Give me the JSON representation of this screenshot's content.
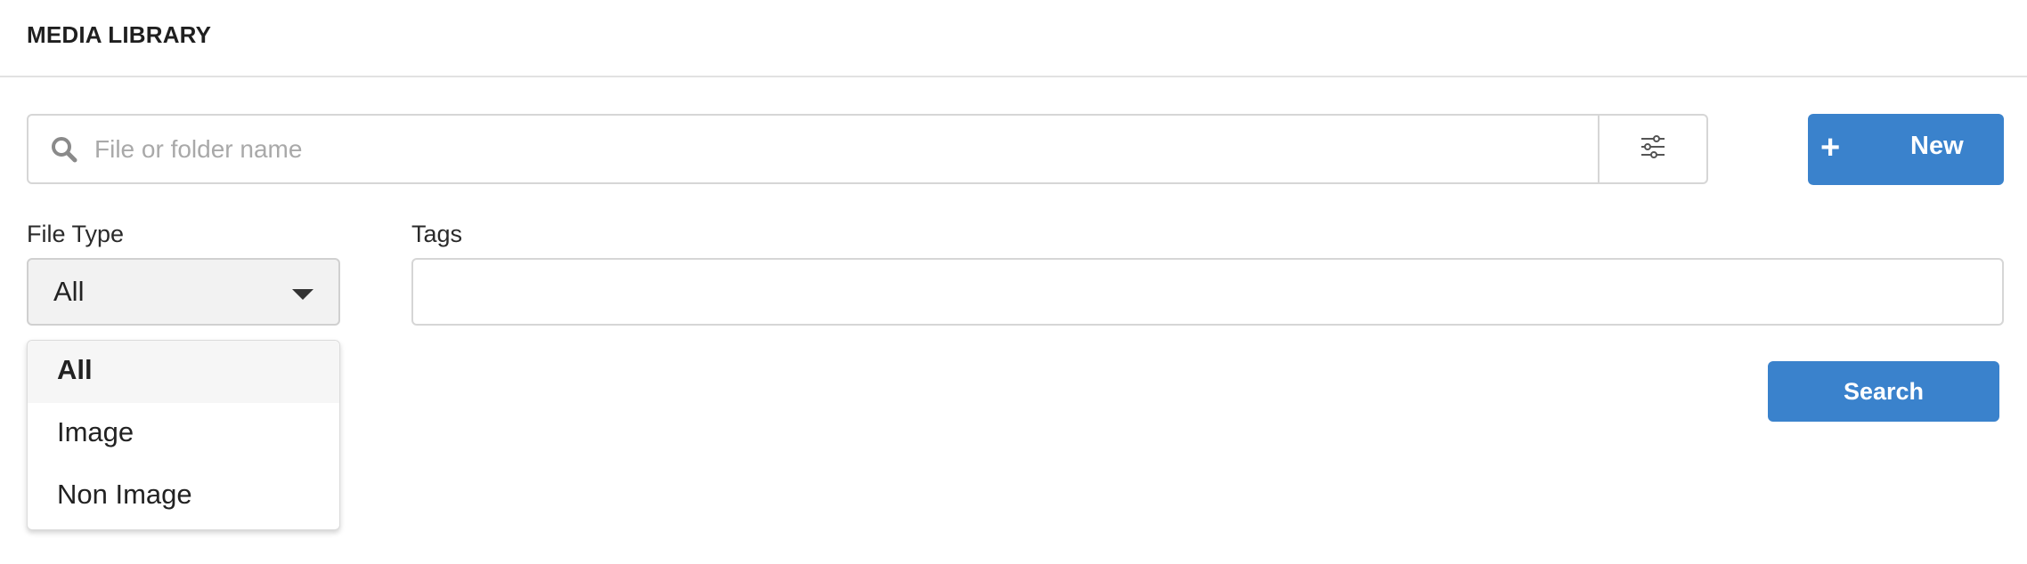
{
  "header": {
    "title": "MEDIA LIBRARY"
  },
  "search": {
    "placeholder": "File or folder name",
    "value": "",
    "icon": "search-icon",
    "filter_icon": "sliders-icon"
  },
  "new_button": {
    "icon": "plus-icon",
    "label": "New"
  },
  "file_type": {
    "label": "File Type",
    "selected": "All",
    "options": [
      "All",
      "Image",
      "Non Image"
    ]
  },
  "tags": {
    "label": "Tags",
    "value": ""
  },
  "search_button": {
    "label": "Search"
  },
  "colors": {
    "accent": "#3a82cc",
    "border": "#d6d6d6",
    "select_bg": "#f2f2f2"
  }
}
